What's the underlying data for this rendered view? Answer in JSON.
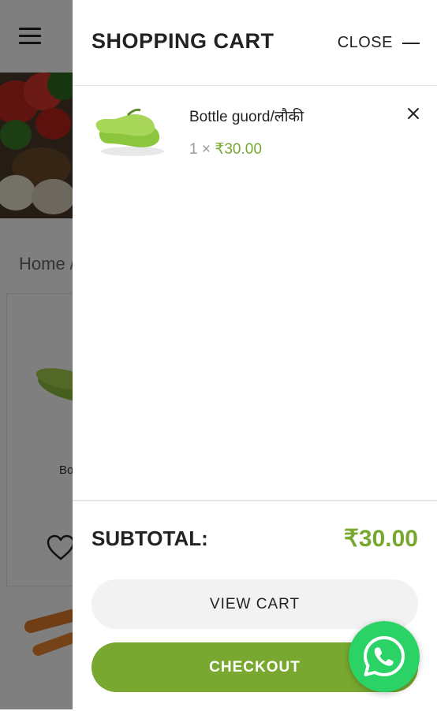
{
  "background_page": {
    "breadcrumb": "Home  /",
    "product_name_partial": "Bo"
  },
  "cart": {
    "title": "SHOPPING CART",
    "close_label": "CLOSE",
    "items": [
      {
        "name": "Bottle guord/लौकी",
        "quantity": "1",
        "times": "×",
        "price": "₹30.00"
      }
    ],
    "subtotal_label": "SUBTOTAL:",
    "subtotal_value": "₹30.00",
    "view_cart_label": "VIEW CART",
    "checkout_label": "CHECKOUT"
  },
  "colors": {
    "accent_green": "#78a82f",
    "whatsapp_green": "#2bd366"
  },
  "icons": {
    "menu": "hamburger-icon",
    "remove": "close-icon",
    "wishlist": "heart-icon",
    "chat": "whatsapp-icon"
  }
}
